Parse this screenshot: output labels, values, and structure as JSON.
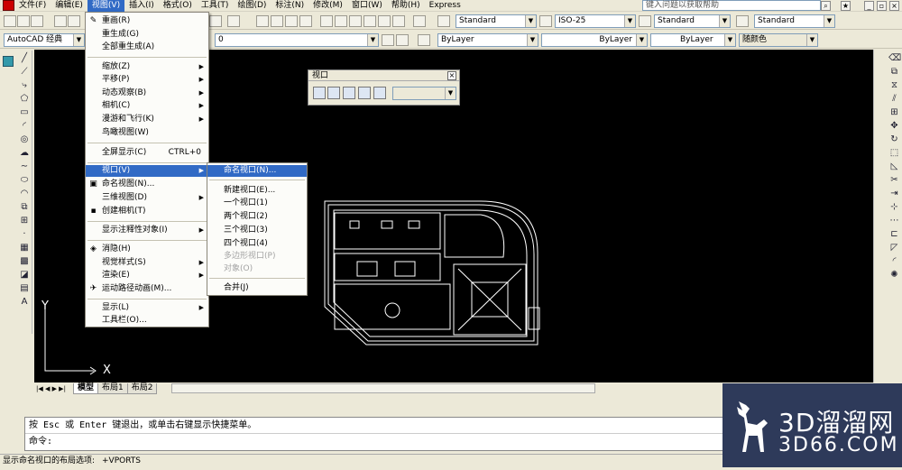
{
  "menubar": {
    "items": [
      "文件(F)",
      "编辑(E)",
      "视图(V)",
      "插入(I)",
      "格式(O)",
      "工具(T)",
      "绘图(D)",
      "标注(N)",
      "修改(M)",
      "窗口(W)",
      "帮助(H)",
      "Express"
    ],
    "help_placeholder": "键入问题以获取帮助"
  },
  "toolbar1": {
    "text_style": "Standard",
    "dim_style": "ISO-25",
    "table_style": "Standard",
    "ml_style": "Standard"
  },
  "toolbar2": {
    "workspace": "AutoCAD 经典",
    "layer": "0",
    "color": "ByLayer",
    "linetype": "ByLayer",
    "lineweight": "ByLayer",
    "plotstyle": "随颜色"
  },
  "view_menu": {
    "items": [
      {
        "label": "重画(R)"
      },
      {
        "label": "重生成(G)"
      },
      {
        "label": "全部重生成(A)"
      },
      {
        "label": "缩放(Z)"
      },
      {
        "label": "平移(P)"
      },
      {
        "label": "动态观察(B)"
      },
      {
        "label": "相机(C)"
      },
      {
        "label": "漫游和飞行(K)"
      },
      {
        "label": "鸟瞰视图(W)"
      },
      {
        "label": "全屏显示(C)",
        "shortcut": "CTRL+0"
      },
      {
        "label": "视口(V)"
      },
      {
        "label": "命名视图(N)..."
      },
      {
        "label": "三维视图(D)"
      },
      {
        "label": "创建相机(T)"
      },
      {
        "label": "显示注释性对象(I)"
      },
      {
        "label": "消隐(H)"
      },
      {
        "label": "视觉样式(S)"
      },
      {
        "label": "渲染(E)"
      },
      {
        "label": "运动路径动画(M)..."
      },
      {
        "label": "显示(L)"
      },
      {
        "label": "工具栏(O)..."
      }
    ]
  },
  "viewport_submenu": {
    "items": [
      {
        "label": "命名视口(N)..."
      },
      {
        "label": "新建视口(E)..."
      },
      {
        "label": "一个视口(1)"
      },
      {
        "label": "两个视口(2)"
      },
      {
        "label": "三个视口(3)"
      },
      {
        "label": "四个视口(4)"
      },
      {
        "label": "多边形视口(P)"
      },
      {
        "label": "对象(O)"
      },
      {
        "label": "合并(J)"
      }
    ]
  },
  "floating_toolbar": {
    "title": "视口"
  },
  "layout_tabs": [
    "模型",
    "布局1",
    "布局2"
  ],
  "command": {
    "line1": "按 Esc 或 Enter 键退出，或单击右键显示快捷菜单。",
    "line2": "命令:"
  },
  "status": {
    "left": "显示命名视口的布局选项:",
    "right": "+VPORTS"
  },
  "ucs": {
    "y": "Y",
    "x": "X"
  },
  "watermark": {
    "line1": "3D溜溜网",
    "line2": "3D66.COM"
  }
}
